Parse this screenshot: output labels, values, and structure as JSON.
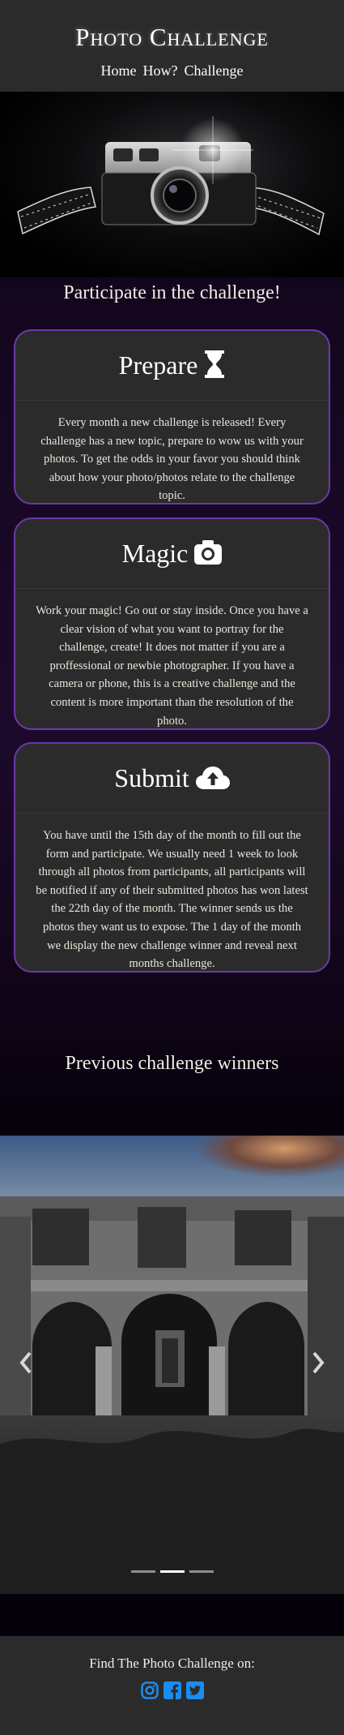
{
  "header": {
    "title": "Photo Challenge",
    "nav": [
      {
        "label": "Home"
      },
      {
        "label": "How?"
      },
      {
        "label": "Challenge"
      }
    ]
  },
  "participate_heading": "Participate in the challenge!",
  "cards": [
    {
      "title": "Prepare",
      "icon": "hourglass-icon",
      "text": "Every month a new challenge is released! Every challenge has a new topic, prepare to wow us with your photos. To get the odds in your favor you should think about how your photo/photos relate to the challenge topic."
    },
    {
      "title": "Magic",
      "icon": "camera-icon",
      "text": "Work your magic! Go out or stay inside. Once you have a clear vision of what you want to portray for the challenge, create! It does not matter if you are a proffessional or newbie photographer. If you have a camera or phone, this is a creative challenge and the content is more important than the resolution of the photo."
    },
    {
      "title": "Submit",
      "icon": "cloud-upload-icon",
      "text": "You have until the 15th day of the month to fill out the form and participate. We usually need 1 week to look through all photos from participants, all participants will be notified if any of their submitted photos has won latest the 22th day of the month. The winner sends us the photos they want us to expose. The 1 day of the month we display the new challenge winner and reveal next months challenge."
    }
  ],
  "previous_heading": "Previous challenge winners",
  "carousel": {
    "slide_count": 3,
    "active_index": 1
  },
  "footer": {
    "text": "Find The Photo Challenge on:",
    "social": [
      "instagram-icon",
      "facebook-icon",
      "twitter-icon"
    ]
  },
  "colors": {
    "accent_border": "#6a39a8",
    "panel": "#2b2b2b",
    "social_blue": "#1b8cf0"
  }
}
